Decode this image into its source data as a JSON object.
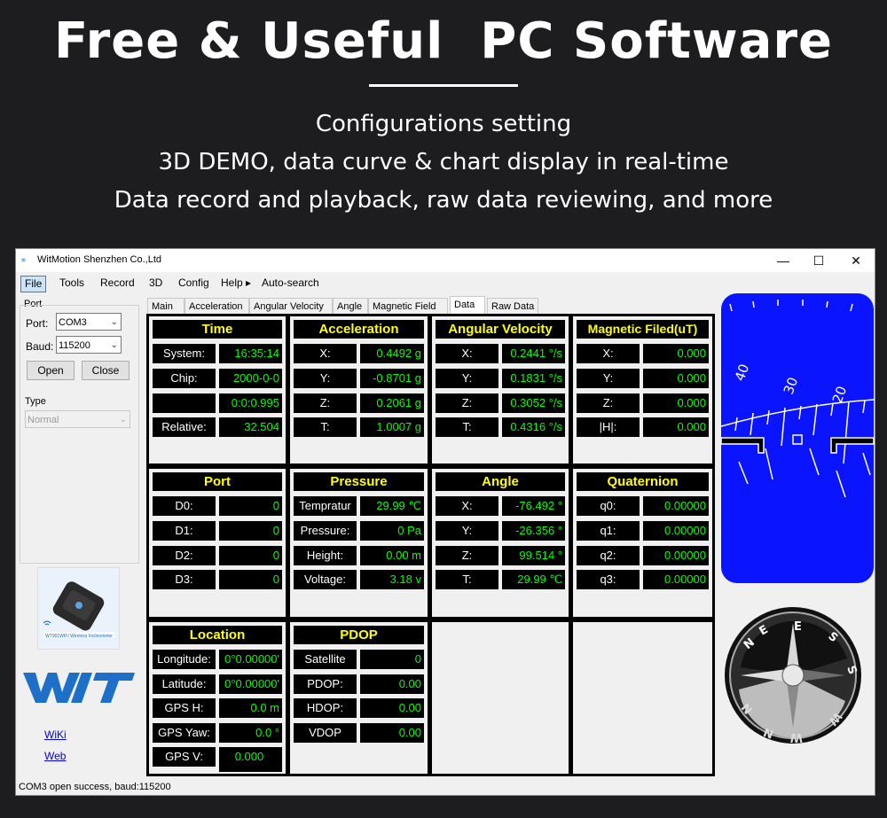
{
  "hero": {
    "title": "Free & Useful  PC Software",
    "lines": [
      "Configurations setting",
      "3D DEMO, data curve & chart display in real-time",
      "Data record and playback, raw data reviewing, and more"
    ]
  },
  "window": {
    "title": "WitMotion Shenzhen Co.,Ltd",
    "controls": {
      "minimize": "—",
      "maximize": "☐",
      "close": "✕"
    },
    "menu": [
      "File",
      "Tools",
      "Record",
      "3D",
      "Config",
      "Help ▸",
      "Auto-search"
    ],
    "port_group": {
      "title": "Port",
      "port_label": "Port:",
      "port_value": "COM3",
      "baud_label": "Baud:",
      "baud_value": "115200",
      "open": "Open",
      "close": "Close"
    },
    "type_group": {
      "title": "Type",
      "value": "Normal"
    },
    "product_caption": "WT901WIFI  Wireless Inclinometer",
    "brand": "WIT",
    "links": [
      "WiKi",
      "Web"
    ],
    "tabs": [
      "Main",
      "Acceleration",
      "Angular Velocity",
      "Angle",
      "Magnetic Field",
      "Data",
      "Raw Data"
    ],
    "active_tab": "Data",
    "status": "COM3 open success, baud:115200"
  },
  "panels": {
    "time": {
      "title": "Time",
      "rows": [
        [
          "System:",
          "16:35:14"
        ],
        [
          "Chip:",
          "2000-0-0"
        ],
        [
          "",
          "0:0:0.995"
        ],
        [
          "Relative:",
          "32.504"
        ]
      ]
    },
    "acceleration": {
      "title": "Acceleration",
      "rows": [
        [
          "X:",
          "0.4492 g"
        ],
        [
          "Y:",
          "-0.8701 g"
        ],
        [
          "Z:",
          "0.2061 g"
        ],
        [
          "T:",
          "1.0007 g"
        ]
      ]
    },
    "angular_velocity": {
      "title": "Angular Velocity",
      "rows": [
        [
          "X:",
          "0.2441 °/s"
        ],
        [
          "Y:",
          "0.1831 °/s"
        ],
        [
          "Z:",
          "0.3052 °/s"
        ],
        [
          "T:",
          "0.4316 °/s"
        ]
      ]
    },
    "magnetic": {
      "title": "Magnetic Filed(uT)",
      "rows": [
        [
          "X:",
          "0.000"
        ],
        [
          "Y:",
          "0.000"
        ],
        [
          "Z:",
          "0.000"
        ],
        [
          "|H|:",
          "0.000"
        ]
      ]
    },
    "port": {
      "title": "Port",
      "rows": [
        [
          "D0:",
          "0"
        ],
        [
          "D1:",
          "0"
        ],
        [
          "D2:",
          "0"
        ],
        [
          "D3:",
          "0"
        ]
      ]
    },
    "pressure": {
      "title": "Pressure",
      "rows": [
        [
          "Tempratur",
          "29.99 ℃"
        ],
        [
          "Pressure:",
          "0 Pa"
        ],
        [
          "Height:",
          "0.00 m"
        ],
        [
          "Voltage:",
          "3.18 v"
        ]
      ]
    },
    "angle": {
      "title": "Angle",
      "rows": [
        [
          "X:",
          "-76.492 °"
        ],
        [
          "Y:",
          "-26.356 °"
        ],
        [
          "Z:",
          "99.514 °"
        ],
        [
          "T:",
          "29.99 ℃"
        ]
      ]
    },
    "quaternion": {
      "title": "Quaternion",
      "rows": [
        [
          "q0:",
          "0.00000"
        ],
        [
          "q1:",
          "0.00000"
        ],
        [
          "q2:",
          "0.00000"
        ],
        [
          "q3:",
          "0.00000"
        ]
      ]
    },
    "location": {
      "title": "Location",
      "rows": [
        [
          "Longitude:",
          "0°0.00000'"
        ],
        [
          "Latitude:",
          "0°0.00000'"
        ],
        [
          "GPS H:",
          "0.0 m"
        ],
        [
          "GPS Yaw:",
          "0.0 °"
        ],
        [
          "GPS V:",
          "0.000"
        ]
      ]
    },
    "pdop": {
      "title": "PDOP",
      "rows": [
        [
          "Satellite",
          "0"
        ],
        [
          "PDOP:",
          "0.00"
        ],
        [
          "HDOP:",
          "0.00"
        ],
        [
          "VDOP",
          "0.00"
        ]
      ]
    }
  },
  "attitude": {
    "ticks": [
      "40",
      "30",
      "20"
    ],
    "sky_color": "#0a14ff"
  },
  "compass": {
    "letters": [
      "N",
      "E",
      "E",
      "S",
      "S",
      "W",
      "W",
      "N",
      "N"
    ]
  }
}
